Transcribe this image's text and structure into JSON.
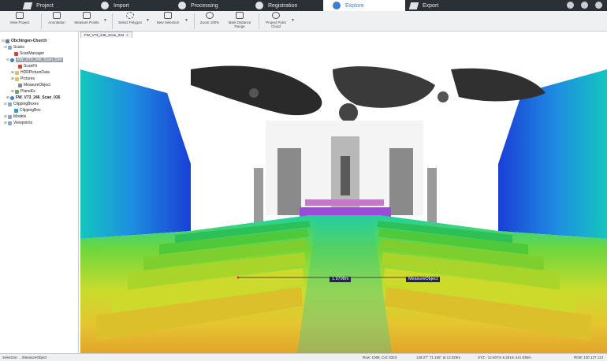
{
  "tabs": [
    {
      "label": "Project",
      "icon": "folder-icon"
    },
    {
      "label": "Import",
      "icon": "import-icon"
    },
    {
      "label": "Processing",
      "icon": "processing-icon"
    },
    {
      "label": "Registration",
      "icon": "registration-icon"
    },
    {
      "label": "Explore",
      "icon": "explore-icon"
    },
    {
      "label": "Export",
      "icon": "export-icon"
    }
  ],
  "active_tab": "Explore",
  "ribbon": {
    "view_project": "View Project",
    "annotation": "Annotation",
    "measure_points": "Measure Points",
    "select_polygon": "Select Polygon",
    "new_selection": "New Selection",
    "zoom_100": "Zoom 100%",
    "mark_distance_range": "Mark Distance Range",
    "project_point_cloud": "Project Point Cloud"
  },
  "tree": {
    "root": "Obchingen-Church",
    "scans": "Scans",
    "scan_manager": "ScanManager",
    "scan_selected": "FW_V73_246_Scan_034",
    "scanfit": "ScanFit",
    "hdr": "HDRPictureData",
    "pictures": "Pictures",
    "measure_object": "MeasureObject",
    "planes": "PlaneEx",
    "scan_next": "FW_V73_246_Scan_036",
    "clipping_boxes": "ClippingBoxes",
    "clipping_box": "ClippingBox",
    "models": "Models",
    "viewpoints": "Viewpoints"
  },
  "viewer": {
    "tab_label": "FW_V73_246_Scan_034",
    "measure_length": "1.9798m",
    "measure_label": "MeasureObject"
  },
  "status": {
    "selection": "Selection: .../MeasureObject",
    "rowcol": "Row: 1068, Col: 8323",
    "angles": "149.27° 71.165° at 13.029m",
    "xyz": "XYZ: -12.607m 6.251m 441.535m",
    "rgb": "RGB: 130 127 114"
  },
  "colors": {
    "accent": "#3b7fd1",
    "topbar": "#2b2f36",
    "measure_badge": "#23235a"
  }
}
